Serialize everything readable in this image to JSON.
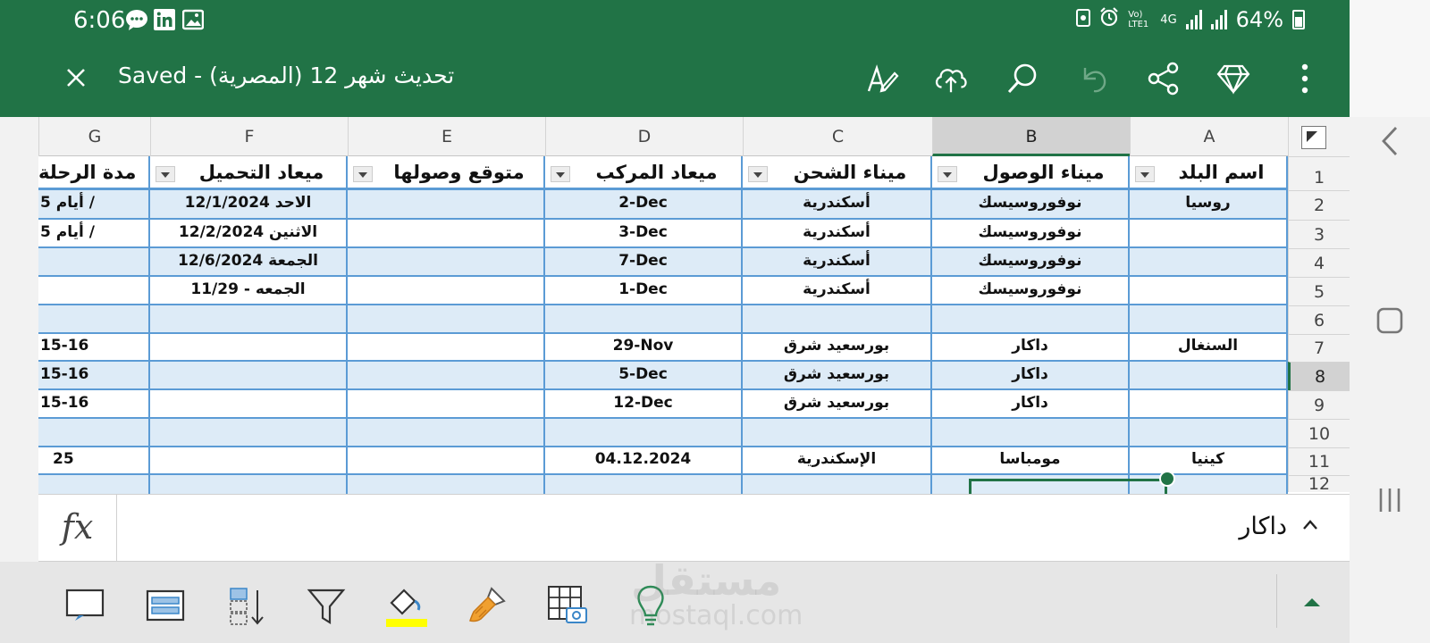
{
  "status_bar": {
    "time": "6:06",
    "battery_percent": "64%",
    "network": "4G",
    "volte": "Vo) LTE1"
  },
  "app_bar": {
    "title": "Saved - (المصرية) تحديث شهر 12"
  },
  "columns": [
    "G",
    "F",
    "E",
    "D",
    "C",
    "B",
    "A"
  ],
  "selected_column": "B",
  "rows": [
    "1",
    "2",
    "3",
    "4",
    "5",
    "6",
    "7",
    "8",
    "9",
    "10",
    "11",
    "12"
  ],
  "selected_row": "8",
  "table_headers": {
    "G": "مدة الرحلة",
    "F": "ميعاد التحميل",
    "E": "متوقع وصولها",
    "D": "ميعاد المركب",
    "C": "ميناء الشحن",
    "B": "ميناء الوصول",
    "A": "اسم البلد"
  },
  "table_rows": [
    {
      "G": "أيام 5 /",
      "F": "الاحد 12/1/2024",
      "E": "",
      "D": "2-Dec",
      "C": "أسكندرية",
      "B": "نوفوروسيسك",
      "A": "روسيا"
    },
    {
      "G": "أيام 5 /",
      "F": "الاثنين 12/2/2024",
      "E": "",
      "D": "3-Dec",
      "C": "أسكندرية",
      "B": "نوفوروسيسك",
      "A": ""
    },
    {
      "G": "",
      "F": "الجمعة 12/6/2024",
      "E": "",
      "D": "7-Dec",
      "C": "أسكندرية",
      "B": "نوفوروسيسك",
      "A": ""
    },
    {
      "G": "",
      "F": "الجمعه - 11/29",
      "E": "",
      "D": "1-Dec",
      "C": "أسكندرية",
      "B": "نوفوروسيسك",
      "A": ""
    },
    {
      "G": "",
      "F": "",
      "E": "",
      "D": "",
      "C": "",
      "B": "",
      "A": ""
    },
    {
      "G": "15-16",
      "F": "",
      "E": "",
      "D": "29-Nov",
      "C": "بورسعيد شرق",
      "B": "داكار",
      "A": "السنغال"
    },
    {
      "G": "15-16",
      "F": "",
      "E": "",
      "D": "5-Dec",
      "C": "بورسعيد شرق",
      "B": "داكار",
      "A": ""
    },
    {
      "G": "15-16",
      "F": "",
      "E": "",
      "D": "12-Dec",
      "C": "بورسعيد شرق",
      "B": "داكار",
      "A": ""
    },
    {
      "G": "",
      "F": "",
      "E": "",
      "D": "",
      "C": "",
      "B": "",
      "A": ""
    },
    {
      "G": "25",
      "F": "",
      "E": "",
      "D": "04.12.2024",
      "C": "الإسكندرية",
      "B": "مومباسا",
      "A": "كينيا"
    }
  ],
  "formula_bar": {
    "fx_label": "fx",
    "value": "داكار"
  },
  "watermark": {
    "arabic": "مستقل",
    "latin": "mostaql.com"
  },
  "colors": {
    "brand": "#217346",
    "table_border": "#5b9bd5",
    "band": "#ddebf7",
    "highlight": "#ffff00",
    "paint": "#f0a030"
  }
}
